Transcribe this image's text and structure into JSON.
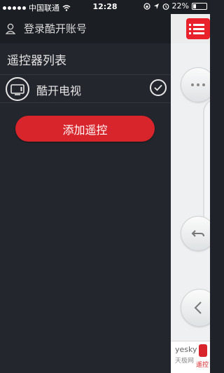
{
  "status_bar": {
    "carrier": "中国联通",
    "time": "12:28",
    "battery_percent": "22%",
    "battery_level": 0.22,
    "icons": [
      "signal-dots-icon",
      "wifi-icon",
      "lock-rotation-icon",
      "location-icon",
      "alarm-icon",
      "battery-icon"
    ]
  },
  "drawer": {
    "login_label": "登录酷开账号",
    "list_title": "遥控器列表",
    "remotes": [
      {
        "name": "酷开电视",
        "selected": true,
        "icon": "tv-icon"
      }
    ],
    "add_button_label": "添加遥控"
  },
  "main": {
    "menu_icon": "menu-icon",
    "buttons": [
      "more-icon",
      "back-icon",
      "chevron-left-icon"
    ]
  },
  "watermark": {
    "brand": "yesky",
    "sub": "天极网",
    "app_label": "遥控"
  },
  "colors": {
    "accent": "#d8252b",
    "drawer_bg": "#23262d",
    "main_bg": "#eef0f1"
  }
}
